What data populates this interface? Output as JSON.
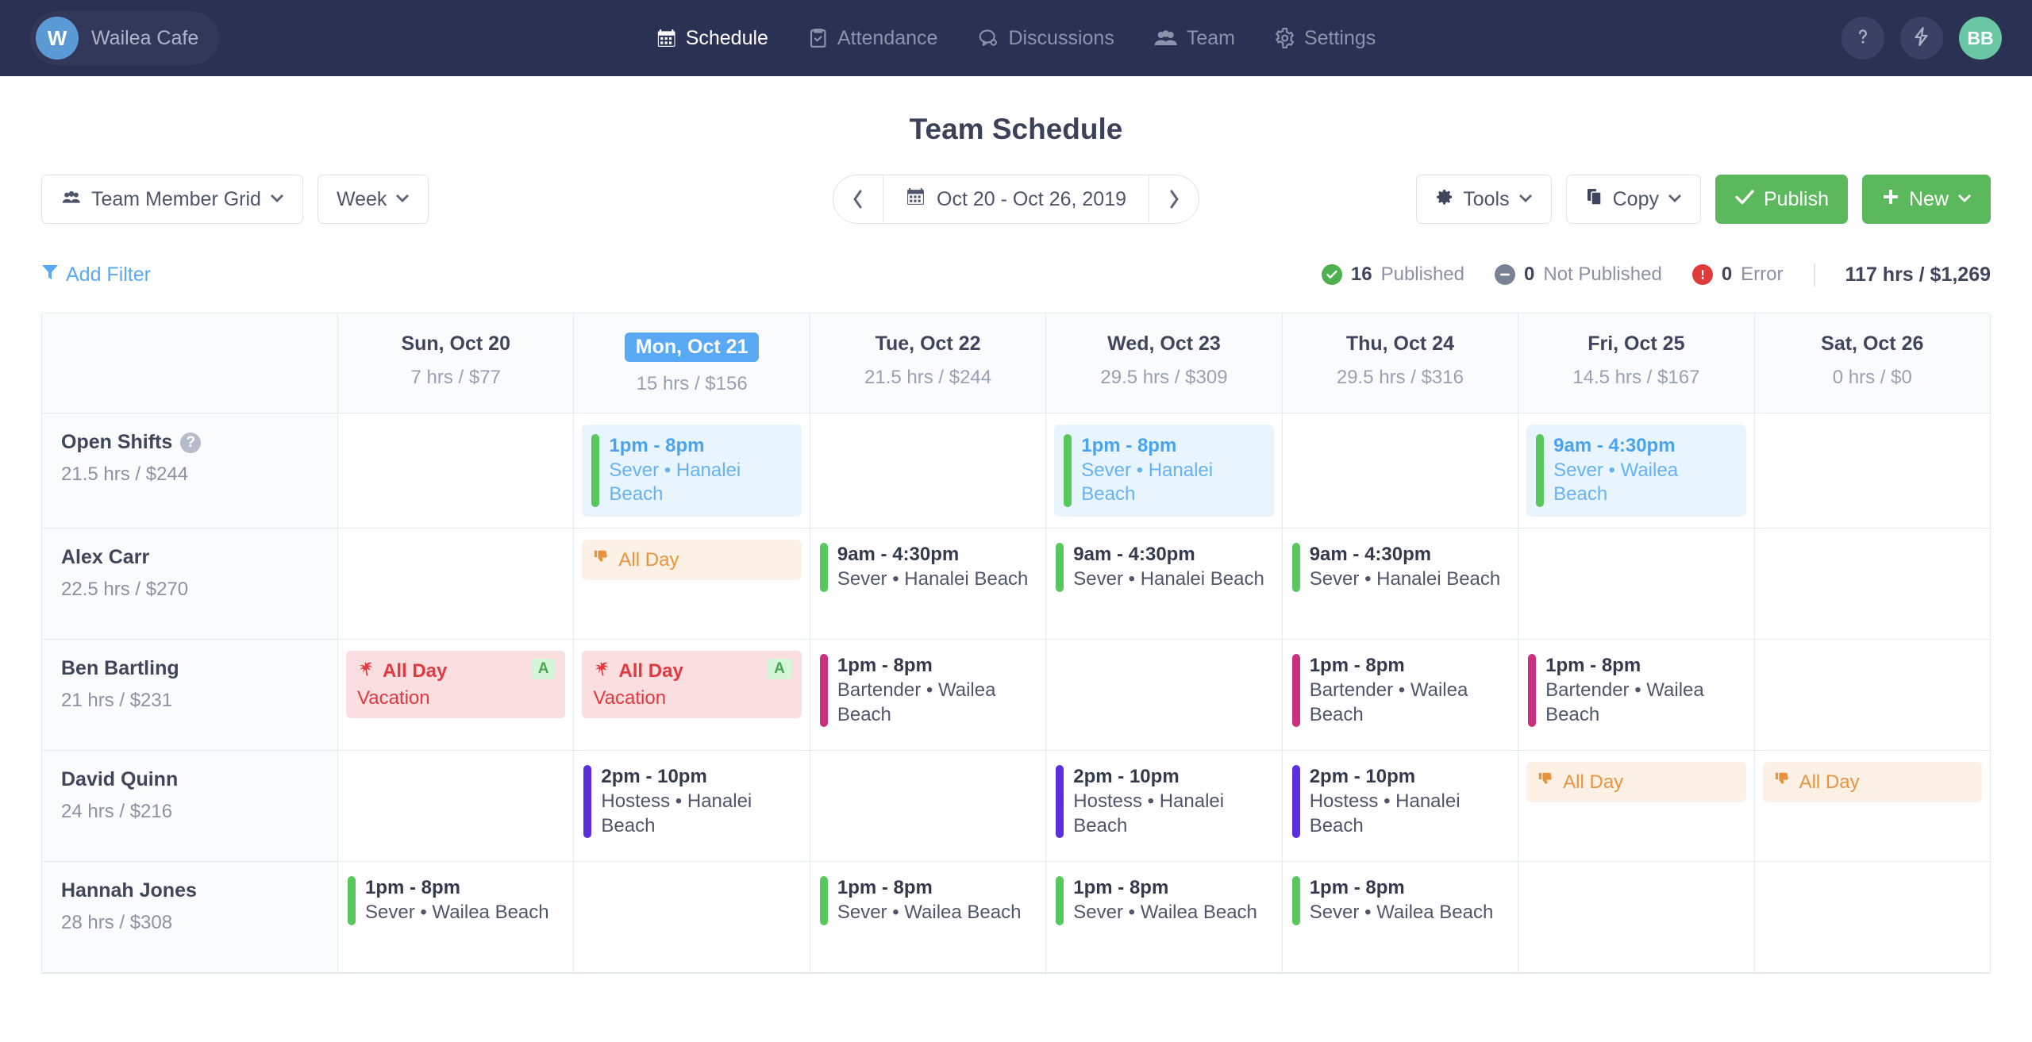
{
  "app": {
    "brand_initial": "W",
    "brand_name": "Wailea Cafe",
    "nav": [
      {
        "label": "Schedule",
        "icon": "calendar-icon",
        "active": true
      },
      {
        "label": "Attendance",
        "icon": "clipboard-check-icon",
        "active": false
      },
      {
        "label": "Discussions",
        "icon": "chat-icon",
        "active": false
      },
      {
        "label": "Team",
        "icon": "people-icon",
        "active": false
      },
      {
        "label": "Settings",
        "icon": "gear-icon",
        "active": false
      }
    ],
    "help_icon": "question-mark-icon",
    "bolt_icon": "lightning-bolt-icon",
    "user_initials": "BB"
  },
  "page": {
    "title": "Team Schedule"
  },
  "toolbar": {
    "view_label": "Team Member Grid",
    "range_label": "Week",
    "date_range": "Oct 20 - Oct 26, 2019",
    "prev_label": "‹",
    "next_label": "›",
    "tools_label": "Tools",
    "copy_label": "Copy",
    "publish_label": "Publish",
    "new_label": "New",
    "caret": "⌄"
  },
  "filters": {
    "add_filter_label": "Add Filter",
    "published": "16",
    "published_label": "Published",
    "not_published": "0",
    "not_published_label": "Not Published",
    "error": "0",
    "error_label": "Error",
    "total": "117 hrs / $1,269"
  },
  "colors": {
    "nav_bg": "#2b3153",
    "accent_blue": "#5aa9f5",
    "green": "#5cb85c",
    "sever_bar": "#57c75e",
    "bartender_bar": "#c9317f",
    "hostess_bar": "#5b2ee0",
    "vacation_red": "#e1393f",
    "unavailable_orange": "#e8943f"
  },
  "grid": {
    "days": [
      {
        "name": "Sun, Oct 20",
        "summary": "7 hrs / $77",
        "today": false
      },
      {
        "name": "Mon, Oct 21",
        "summary": "15 hrs / $156",
        "today": true
      },
      {
        "name": "Tue, Oct 22",
        "summary": "21.5 hrs / $244",
        "today": false
      },
      {
        "name": "Wed, Oct 23",
        "summary": "29.5 hrs / $309",
        "today": false
      },
      {
        "name": "Thu, Oct 24",
        "summary": "29.5 hrs / $316",
        "today": false
      },
      {
        "name": "Fri, Oct 25",
        "summary": "14.5 hrs / $167",
        "today": false
      },
      {
        "name": "Sat, Oct 26",
        "summary": "0 hrs / $0",
        "today": false
      }
    ],
    "rows": [
      {
        "name": "Open Shifts",
        "summary": "21.5 hrs / $244",
        "has_help": true,
        "cells": [
          [],
          [
            {
              "kind": "open",
              "time": "1pm - 8pm",
              "desc": "Sever • Hanalei Beach",
              "bar": "green"
            }
          ],
          [],
          [
            {
              "kind": "open",
              "time": "1pm - 8pm",
              "desc": "Sever • Hanalei Beach",
              "bar": "green"
            }
          ],
          [],
          [
            {
              "kind": "open",
              "time": "9am - 4:30pm",
              "desc": "Sever • Wailea Beach",
              "bar": "green"
            }
          ],
          []
        ]
      },
      {
        "name": "Alex Carr",
        "summary": "22.5 hrs / $270",
        "has_help": false,
        "cells": [
          [],
          [
            {
              "kind": "allday",
              "label": "All Day",
              "icon": "thumbs-down-icon"
            }
          ],
          [
            {
              "kind": "shift",
              "time": "9am - 4:30pm",
              "desc": "Sever • Hanalei Beach",
              "bar": "green"
            }
          ],
          [
            {
              "kind": "shift",
              "time": "9am - 4:30pm",
              "desc": "Sever • Hanalei Beach",
              "bar": "green"
            }
          ],
          [
            {
              "kind": "shift",
              "time": "9am - 4:30pm",
              "desc": "Sever • Hanalei Beach",
              "bar": "green"
            }
          ],
          [],
          []
        ]
      },
      {
        "name": "Ben Bartling",
        "summary": "21 hrs / $231",
        "has_help": false,
        "cells": [
          [
            {
              "kind": "vacation",
              "label": "All Day",
              "sub": "Vacation",
              "badge": "A",
              "icon": "palm-tree-icon"
            }
          ],
          [
            {
              "kind": "vacation",
              "label": "All Day",
              "sub": "Vacation",
              "badge": "A",
              "icon": "palm-tree-icon"
            }
          ],
          [
            {
              "kind": "shift",
              "time": "1pm - 8pm",
              "desc": "Bartender • Wailea Beach",
              "bar": "pink"
            }
          ],
          [],
          [
            {
              "kind": "shift",
              "time": "1pm - 8pm",
              "desc": "Bartender • Wailea Beach",
              "bar": "pink"
            }
          ],
          [
            {
              "kind": "shift",
              "time": "1pm - 8pm",
              "desc": "Bartender • Wailea Beach",
              "bar": "pink"
            }
          ],
          []
        ]
      },
      {
        "name": "David Quinn",
        "summary": "24 hrs / $216",
        "has_help": false,
        "cells": [
          [],
          [
            {
              "kind": "shift",
              "time": "2pm - 10pm",
              "desc": "Hostess • Hanalei Beach",
              "bar": "indigo"
            }
          ],
          [],
          [
            {
              "kind": "shift",
              "time": "2pm - 10pm",
              "desc": "Hostess • Hanalei Beach",
              "bar": "indigo"
            }
          ],
          [
            {
              "kind": "shift",
              "time": "2pm - 10pm",
              "desc": "Hostess • Hanalei Beach",
              "bar": "indigo"
            }
          ],
          [
            {
              "kind": "allday",
              "label": "All Day",
              "icon": "thumbs-down-icon"
            }
          ],
          [
            {
              "kind": "allday",
              "label": "All Day",
              "icon": "thumbs-down-icon"
            }
          ]
        ]
      },
      {
        "name": "Hannah Jones",
        "summary": "28 hrs / $308",
        "has_help": false,
        "cells": [
          [
            {
              "kind": "shift",
              "time": "1pm - 8pm",
              "desc": "Sever • Wailea Beach",
              "bar": "green"
            }
          ],
          [],
          [
            {
              "kind": "shift",
              "time": "1pm - 8pm",
              "desc": "Sever • Wailea Beach",
              "bar": "green"
            }
          ],
          [
            {
              "kind": "shift",
              "time": "1pm - 8pm",
              "desc": "Sever • Wailea Beach",
              "bar": "green"
            }
          ],
          [
            {
              "kind": "shift",
              "time": "1pm - 8pm",
              "desc": "Sever • Wailea Beach",
              "bar": "green"
            }
          ],
          [],
          []
        ]
      }
    ]
  }
}
